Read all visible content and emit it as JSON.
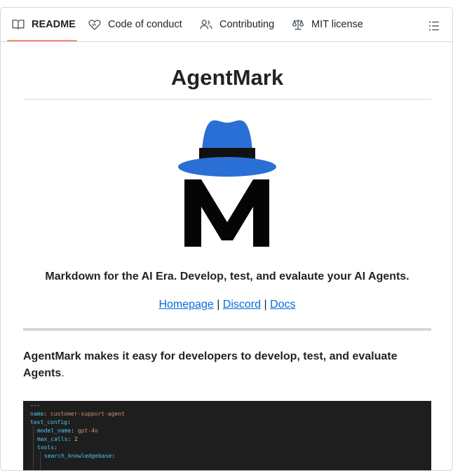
{
  "tabs": [
    {
      "label": "README",
      "icon": "book-icon",
      "active": true
    },
    {
      "label": "Code of conduct",
      "icon": "heart-handshake-icon",
      "active": false
    },
    {
      "label": "Contributing",
      "icon": "people-icon",
      "active": false
    },
    {
      "label": "MIT license",
      "icon": "scale-icon",
      "active": false
    }
  ],
  "outline_icon": "list-icon",
  "readme": {
    "title": "AgentMark",
    "logo_icon": "hat-m-logo",
    "tagline": "Markdown for the AI Era. Develop, test, and evalaute your AI Agents.",
    "links": [
      {
        "label": "Homepage"
      },
      {
        "label": "Discord"
      },
      {
        "label": "Docs"
      }
    ],
    "link_separator": "|",
    "intro_bold": "AgentMark makes it easy for developers to develop, test, and evaluate Agents",
    "intro_tail": ".",
    "code_lines": [
      {
        "key": "---",
        "val": ""
      },
      {
        "key": "name",
        "val": "customer-support-agent"
      },
      {
        "key": "text_config",
        "val": ""
      },
      {
        "key": "model_name",
        "val": "gpt-4o"
      },
      {
        "key": "max_calls",
        "val": "2"
      },
      {
        "key": "tools",
        "val": ""
      },
      {
        "key": "search_knowledgebase",
        "val": ""
      }
    ]
  },
  "colors": {
    "accent_underline": "#fd8c73",
    "link": "#0969da",
    "hat_blue": "#2a6fd6",
    "code_bg": "#1e1e1e"
  }
}
